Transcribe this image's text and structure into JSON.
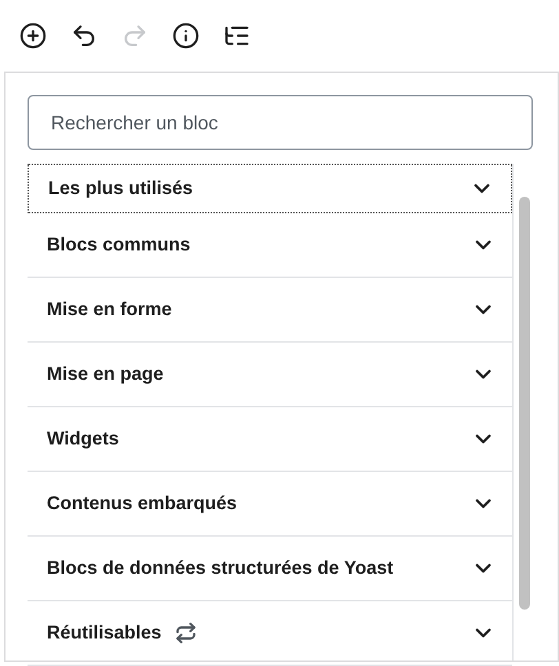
{
  "toolbar": [
    {
      "kind": "add",
      "disabled": false
    },
    {
      "kind": "undo",
      "disabled": false
    },
    {
      "kind": "redo",
      "disabled": true
    },
    {
      "kind": "info",
      "disabled": false
    },
    {
      "kind": "outline",
      "disabled": false
    }
  ],
  "search": {
    "placeholder": "Rechercher un bloc"
  },
  "categories": [
    {
      "label": "Les plus utilisés",
      "kind": "category",
      "focused": true,
      "expanded": false
    },
    {
      "label": "Blocs communs",
      "kind": "category",
      "focused": false,
      "expanded": false
    },
    {
      "label": "Mise en forme",
      "kind": "category",
      "focused": false,
      "expanded": false
    },
    {
      "label": "Mise en page",
      "kind": "category",
      "focused": false,
      "expanded": false
    },
    {
      "label": "Widgets",
      "kind": "category",
      "focused": false,
      "expanded": false
    },
    {
      "label": "Contenus embarqués",
      "kind": "category",
      "focused": false,
      "expanded": false
    },
    {
      "label": "Blocs de données structurées de Yoast",
      "kind": "category",
      "focused": false,
      "expanded": false
    },
    {
      "label": "Réutilisables",
      "kind": "reusable",
      "focused": false,
      "expanded": false
    }
  ]
}
